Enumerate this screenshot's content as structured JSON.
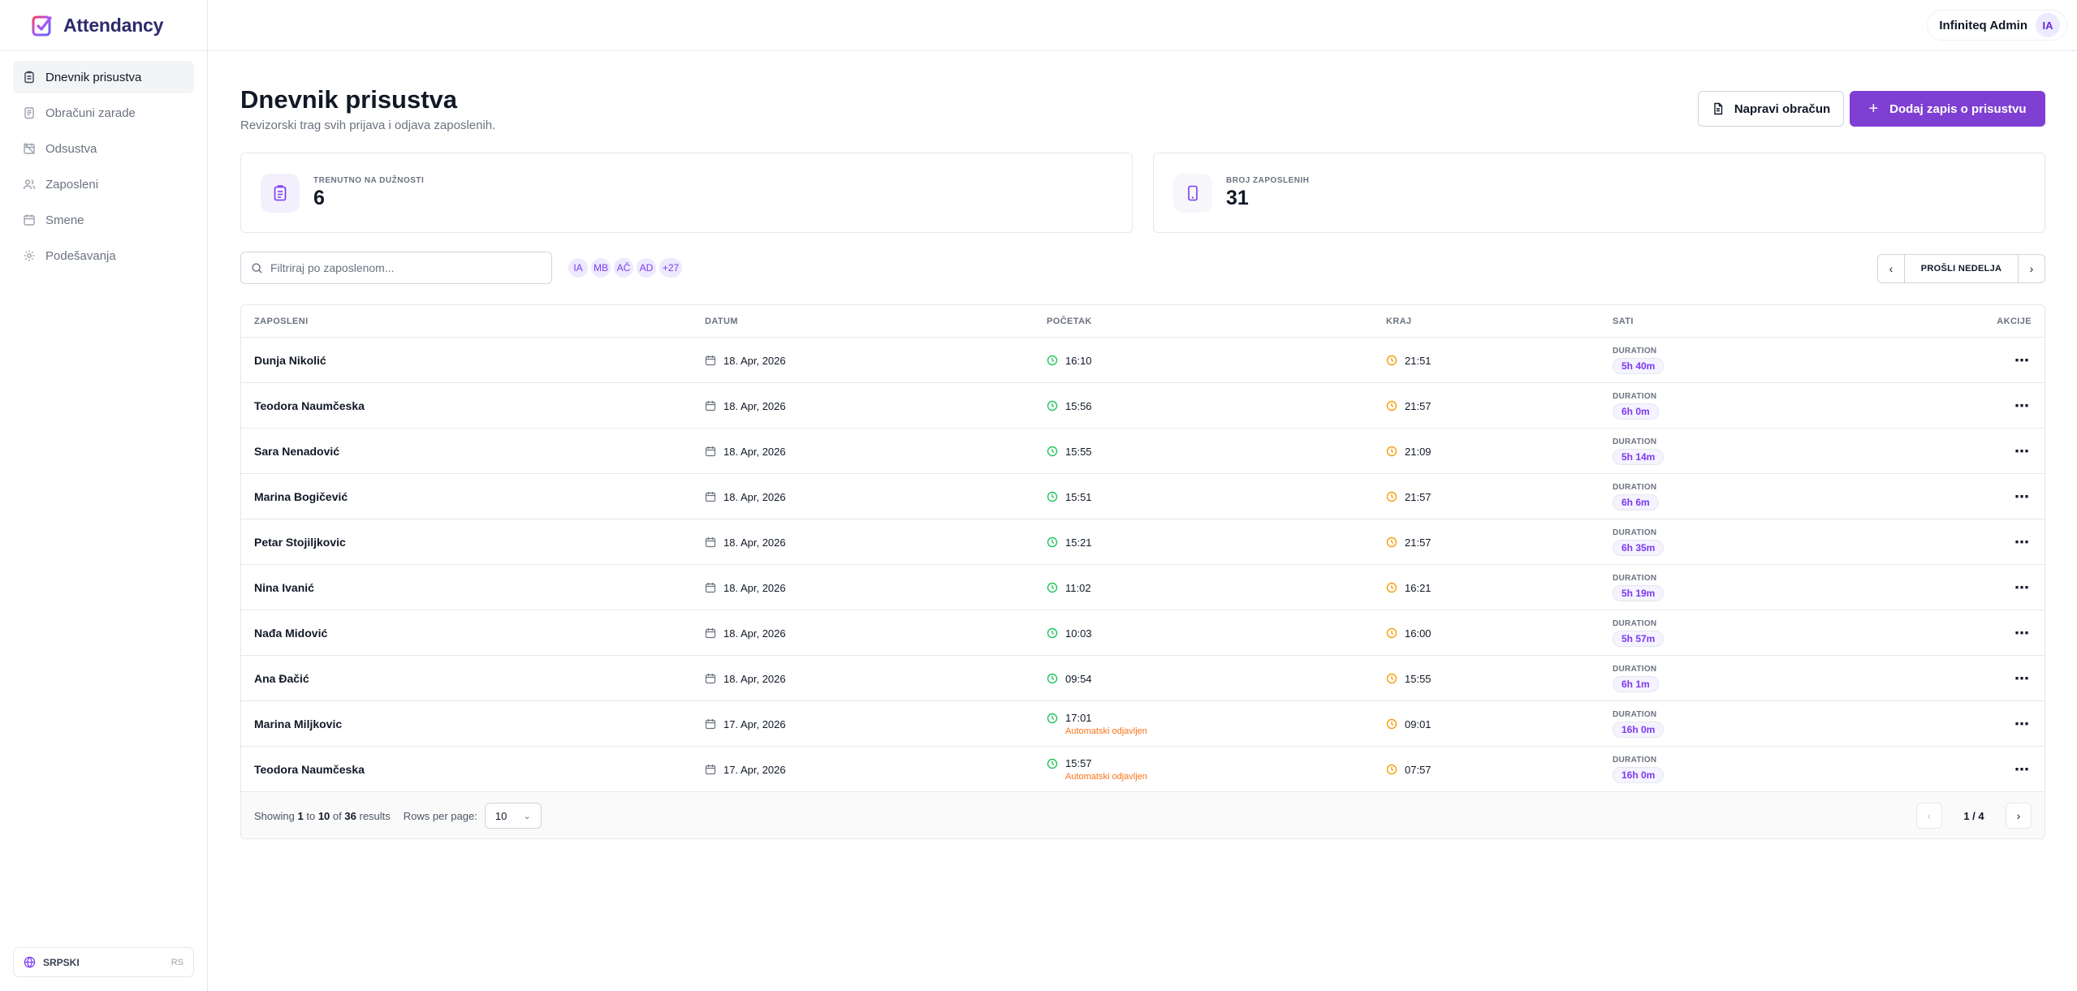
{
  "brand": {
    "name": "Attendancy"
  },
  "sidebar": {
    "items": [
      {
        "label": "Dnevnik prisustva",
        "icon": "clipboard-icon",
        "active": true
      },
      {
        "label": "Obračuni zarade",
        "icon": "receipt-icon",
        "active": false
      },
      {
        "label": "Odsustva",
        "icon": "calendar-off-icon",
        "active": false
      },
      {
        "label": "Zaposleni",
        "icon": "users-icon",
        "active": false
      },
      {
        "label": "Smene",
        "icon": "calendar-icon",
        "active": false
      },
      {
        "label": "Podešavanja",
        "icon": "gear-icon",
        "active": false
      }
    ],
    "language": {
      "label": "SRPSKI",
      "code": "RS"
    }
  },
  "topbar": {
    "user_name": "Infiniteq Admin",
    "user_initials": "IA"
  },
  "page": {
    "title": "Dnevnik prisustva",
    "subtitle": "Revizorski trag svih prijava i odjava zaposlenih.",
    "btn_payroll": "Napravi obračun",
    "btn_add": "Dodaj zapis o prisustvu"
  },
  "stats": {
    "on_duty_label": "TRENUTNO NA DUŽNOSTI",
    "on_duty_value": "6",
    "employees_label": "BROJ ZAPOSLENIH",
    "employees_value": "31"
  },
  "filter": {
    "placeholder": "Filtriraj po zaposlenom...",
    "avatars": [
      "IA",
      "MB",
      "AČ",
      "AD",
      "+27"
    ]
  },
  "week_nav": {
    "label": "PROŠLI NEDELJA"
  },
  "table": {
    "headers": {
      "employee": "ZAPOSLENI",
      "date": "DATUM",
      "start": "POČETAK",
      "end": "KRAJ",
      "hours": "SATI",
      "actions": "AKCIJE"
    },
    "duration_label": "DURATION",
    "rows": [
      {
        "name": "Dunja Nikolić",
        "date": "18. Apr, 2026",
        "start": "16:10",
        "end": "21:51",
        "duration": "5h 40m",
        "note": ""
      },
      {
        "name": "Teodora Naumčeska",
        "date": "18. Apr, 2026",
        "start": "15:56",
        "end": "21:57",
        "duration": "6h 0m",
        "note": ""
      },
      {
        "name": "Sara Nenadović",
        "date": "18. Apr, 2026",
        "start": "15:55",
        "end": "21:09",
        "duration": "5h 14m",
        "note": ""
      },
      {
        "name": "Marina Bogičević",
        "date": "18. Apr, 2026",
        "start": "15:51",
        "end": "21:57",
        "duration": "6h 6m",
        "note": ""
      },
      {
        "name": "Petar Stojiljkovic",
        "date": "18. Apr, 2026",
        "start": "15:21",
        "end": "21:57",
        "duration": "6h 35m",
        "note": ""
      },
      {
        "name": "Nina Ivanić",
        "date": "18. Apr, 2026",
        "start": "11:02",
        "end": "16:21",
        "duration": "5h 19m",
        "note": ""
      },
      {
        "name": "Nađa Midović",
        "date": "18. Apr, 2026",
        "start": "10:03",
        "end": "16:00",
        "duration": "5h 57m",
        "note": ""
      },
      {
        "name": "Ana Đačić",
        "date": "18. Apr, 2026",
        "start": "09:54",
        "end": "15:55",
        "duration": "6h 1m",
        "note": ""
      },
      {
        "name": "Marina Miljkovic",
        "date": "17. Apr, 2026",
        "start": "17:01",
        "end": "09:01",
        "duration": "16h 0m",
        "note": "Automatski odjavljen"
      },
      {
        "name": "Teodora Naumčeska",
        "date": "17. Apr, 2026",
        "start": "15:57",
        "end": "07:57",
        "duration": "16h 0m",
        "note": "Automatski odjavljen"
      }
    ]
  },
  "footer": {
    "showing_prefix": "Showing",
    "from": "1",
    "to_word": "to",
    "to": "10",
    "of_word": "of",
    "total": "36",
    "results_word": "results",
    "rows_per_page_label": "Rows per page:",
    "rows_per_page_value": "10",
    "page_info": "1 / 4"
  },
  "colors": {
    "accent": "#7e3fd2",
    "start_icon": "#22c55e",
    "end_icon": "#f59e0b",
    "auto_note": "#f97316"
  }
}
